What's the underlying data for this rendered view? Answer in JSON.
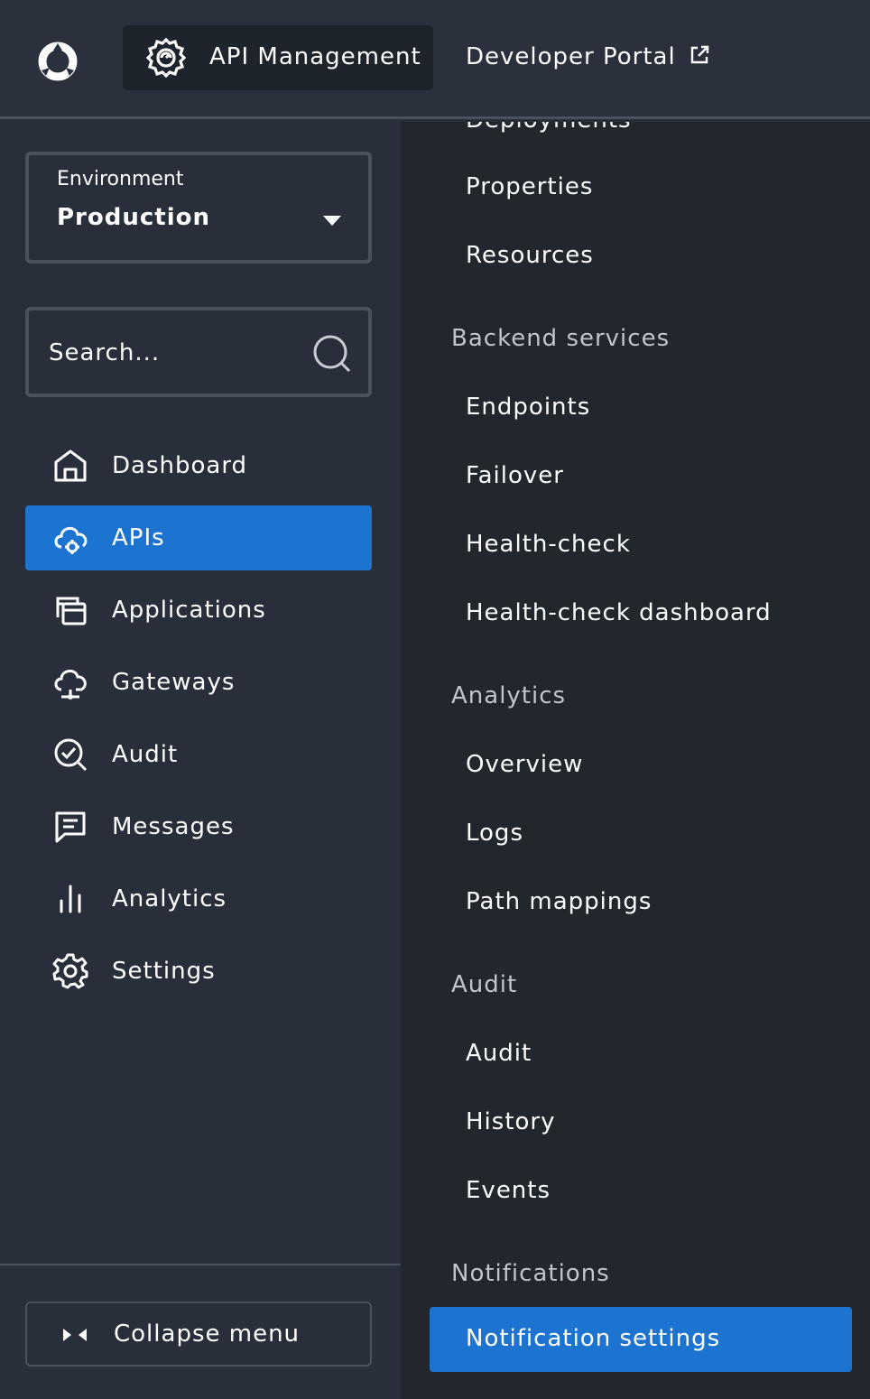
{
  "header": {
    "app_name": "API Management",
    "portal_link": "Developer Portal"
  },
  "environment": {
    "label": "Environment",
    "value": "Production"
  },
  "search": {
    "placeholder": "Search..."
  },
  "nav": {
    "items": [
      {
        "label": "Dashboard",
        "icon": "home-icon"
      },
      {
        "label": "APIs",
        "icon": "cloud-gear-icon",
        "active": true
      },
      {
        "label": "Applications",
        "icon": "applications-icon"
      },
      {
        "label": "Gateways",
        "icon": "cloud-gateway-icon"
      },
      {
        "label": "Audit",
        "icon": "audit-icon"
      },
      {
        "label": "Messages",
        "icon": "message-icon"
      },
      {
        "label": "Analytics",
        "icon": "analytics-icon"
      },
      {
        "label": "Settings",
        "icon": "gear-icon"
      }
    ],
    "collapse_label": "Collapse menu"
  },
  "submenu": {
    "partial_top": "Deployments",
    "items": {
      "properties": "Properties",
      "resources": "Resources",
      "backend_heading": "Backend services",
      "endpoints": "Endpoints",
      "failover": "Failover",
      "health_check": "Health-check",
      "health_dashboard": "Health-check dashboard",
      "analytics_heading": "Analytics",
      "overview": "Overview",
      "logs": "Logs",
      "path_mappings": "Path mappings",
      "audit_heading": "Audit",
      "audit": "Audit",
      "history": "History",
      "events": "Events",
      "notifications_heading": "Notifications",
      "notification_settings": "Notification settings"
    }
  },
  "colors": {
    "accent": "#1d74d0",
    "sidebar_bg": "#282f3a",
    "submenu_bg": "#22272e"
  }
}
